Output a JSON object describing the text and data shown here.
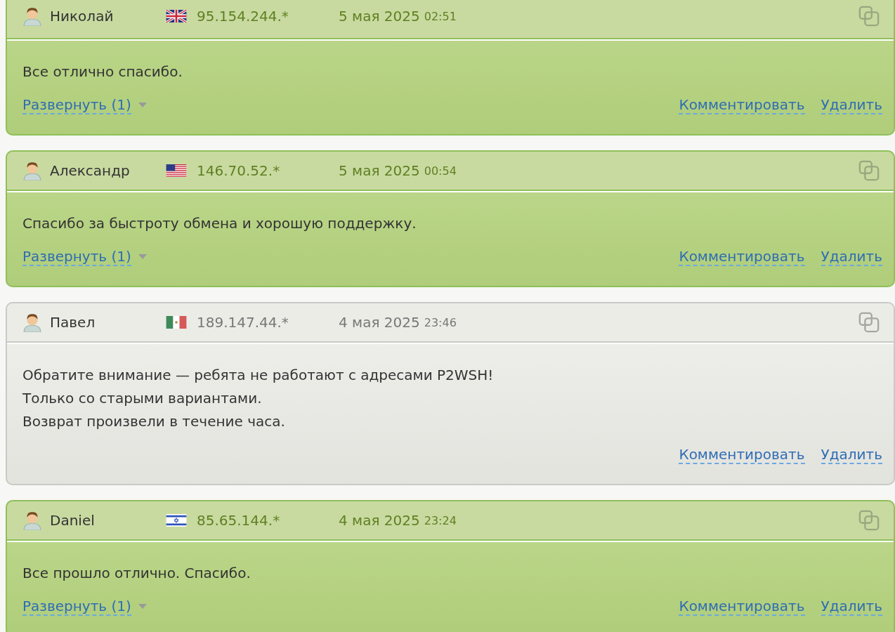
{
  "reviews": [
    {
      "kind": "positive",
      "author": "Николай",
      "flag": {
        "kind": "uk"
      },
      "ip": "95.154.244.*",
      "date": "5 мая 2025",
      "time": "02:51",
      "lines": [
        "Все отлично спасибо."
      ],
      "expand": "Развернуть (1)",
      "comment": "Комментировать",
      "delete": "Удалить"
    },
    {
      "kind": "positive",
      "author": "Александр",
      "flag": {
        "kind": "us"
      },
      "ip": "146.70.52.*",
      "date": "5 мая 2025",
      "time": "00:54",
      "lines": [
        "Спасибо за быстроту обмена и хорошую поддержку."
      ],
      "expand": "Развернуть (1)",
      "comment": "Комментировать",
      "delete": "Удалить"
    },
    {
      "kind": "neutral",
      "author": "Павел",
      "flag": {
        "kind": "mx"
      },
      "ip": "189.147.44.*",
      "date": "4 мая 2025",
      "time": "23:46",
      "lines": [
        "Обратите внимание — ребята не работают с адресами P2WSH!",
        "Только со старыми вариантами.",
        "Возврат произвели в течение часа."
      ],
      "comment": "Комментировать",
      "delete": "Удалить"
    },
    {
      "kind": "positive",
      "author": "Daniel",
      "flag": {
        "kind": "il"
      },
      "ip": "85.65.144.*",
      "date": "4 мая 2025",
      "time": "23:24",
      "lines": [
        "Все прошло отлично. Спасибо."
      ],
      "expand": "Развернуть (1)",
      "comment": "Комментировать",
      "delete": "Удалить"
    }
  ]
}
